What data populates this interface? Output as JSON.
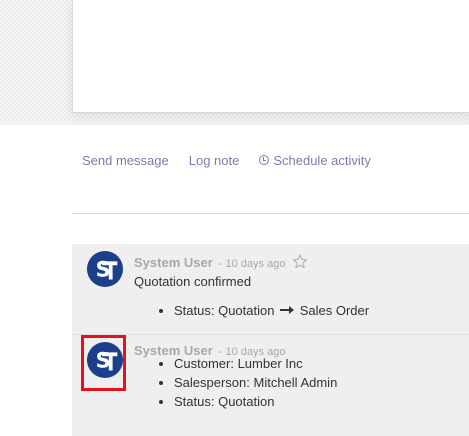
{
  "chatter": {
    "send_message": "Send message",
    "log_note": "Log note",
    "schedule_activity": "Schedule activity"
  },
  "colors": {
    "link": "#7c7bad",
    "avatar_blue": "#1c3f8c",
    "highlight": "#e5121b"
  },
  "messages": [
    {
      "author": "System User",
      "date": "- 10 days ago",
      "body": "Quotation confirmed",
      "tracking": [
        {
          "field": "Status:",
          "old": "Quotation",
          "new": "Sales Order"
        }
      ]
    },
    {
      "author": "System User",
      "date": "- 10 days ago",
      "tracking": [
        {
          "text": "Customer: Lumber Inc"
        },
        {
          "text": "Salesperson: Mitchell Admin"
        },
        {
          "text": "Status: Quotation"
        }
      ]
    }
  ]
}
